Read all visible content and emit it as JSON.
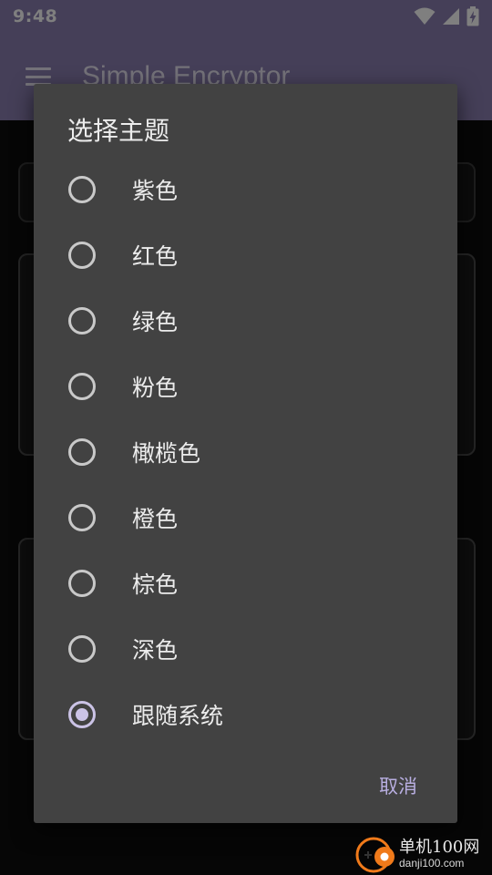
{
  "status_bar": {
    "time": "9:48",
    "icons": [
      "wifi-icon",
      "signal-icon",
      "battery-charging-icon"
    ]
  },
  "app_bar": {
    "title": "Simple Encryptor",
    "menu_icon": "menu-icon"
  },
  "dialog": {
    "title": "选择主题",
    "options": [
      {
        "label": "紫色",
        "selected": false
      },
      {
        "label": "红色",
        "selected": false
      },
      {
        "label": "绿色",
        "selected": false
      },
      {
        "label": "粉色",
        "selected": false
      },
      {
        "label": "橄榄色",
        "selected": false
      },
      {
        "label": "橙色",
        "selected": false
      },
      {
        "label": "棕色",
        "selected": false
      },
      {
        "label": "深色",
        "selected": false
      },
      {
        "label": "跟随系统",
        "selected": true
      }
    ],
    "cancel_label": "取消"
  },
  "watermark": {
    "title": "单机100网",
    "subtitle": "danji100.com"
  },
  "colors": {
    "primary": "#8a7fb0",
    "accent": "#cbc3e6",
    "dialog_bg": "#424242"
  }
}
